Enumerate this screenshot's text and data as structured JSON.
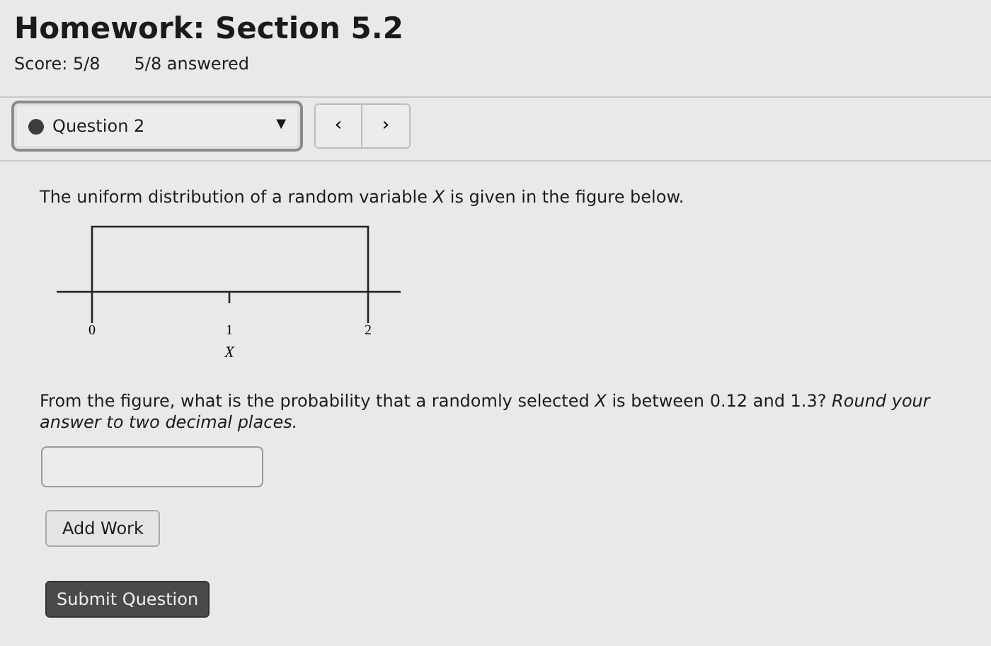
{
  "title": "Homework: Section 5.2",
  "score": "Score: 5/8",
  "answered": "5/8 answered",
  "question_select": {
    "label": "Question 2",
    "caret": "▼"
  },
  "nav_buttons": [
    "‹",
    "›"
  ],
  "intro": "The uniform distribution of a random variable *X* is given in the figure below.",
  "figure": {
    "tick_labels": [
      "0",
      "1",
      "2"
    ],
    "axis_label": "X"
  },
  "question": "From the figure, what is the probability that a randomly selected *X* is between 0.12 and 1.3? *Round your answer to two decimal places.*",
  "buttons": [
    {
      "label": "Add Work",
      "kind": "secondary"
    },
    {
      "label": "Submit Question",
      "kind": "primary"
    }
  ]
}
